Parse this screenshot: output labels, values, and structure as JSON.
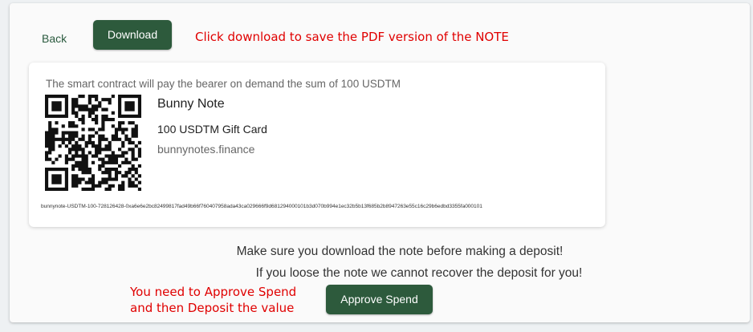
{
  "toolbar": {
    "back_label": "Back",
    "download_label": "Download",
    "download_hint": "Click download to save the PDF version of the NOTE"
  },
  "note": {
    "bearer_text": "The smart contract will pay the bearer on demand the sum of 100 USDTM",
    "title": "Bunny Note",
    "subtitle": "100 USDTM Gift Card",
    "site": "bunnynotes.finance",
    "note_string": "bunnynote-USDTM-100-728126428-0xa6e6e2bc82499817fad49b66f760407958ada43ca029666f9d681294000101b3d070b994e1ec32b5b13f685b2b8947263e55c16c29b6edbd3355fa000101",
    "qr_icon": "qr-code-icon"
  },
  "warnings": {
    "line1": "Make sure you download the note before making a deposit!",
    "line2": "If you loose the note we cannot recover the deposit for you!"
  },
  "approve": {
    "hint_line1": "You need to Approve Spend",
    "hint_line2": "and then Deposit the value",
    "button_label": "Approve Spend"
  },
  "colors": {
    "accent": "#2d5a3c",
    "hint": "#e00000",
    "background": "#eef1f3"
  }
}
